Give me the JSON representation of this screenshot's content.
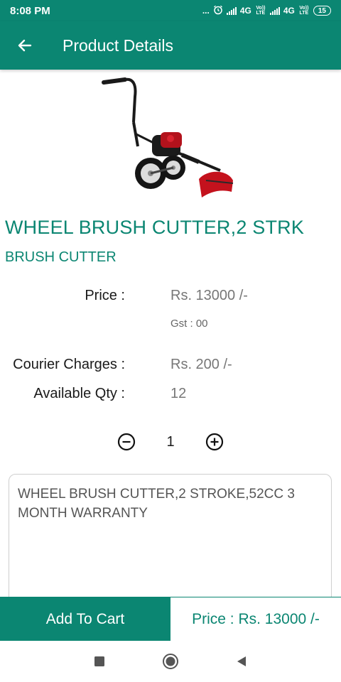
{
  "status_bar": {
    "time": "8:08 PM",
    "dots": "...",
    "network_1": "4G",
    "network_2": "4G",
    "volte_1": "Vo)) LTE",
    "volte_2": "Vo)) LTE",
    "battery": "15",
    "icons": [
      "alarm-icon",
      "signal-icon",
      "battery-icon"
    ]
  },
  "app_bar": {
    "title": "Product Details",
    "back_icon": "back-arrow-icon"
  },
  "product": {
    "image_icon": "wheel-brush-cutter-image",
    "name": "WHEEL BRUSH CUTTER,2 STRK",
    "category": "BRUSH CUTTER",
    "price_label": "Price :",
    "price_value": "Rs. 13000 /-",
    "gst": "Gst : 00",
    "courier_label": "Courier Charges :",
    "courier_value": "Rs. 200 /-",
    "qty_label": "Available Qty :",
    "qty_value": "12",
    "description": "WHEEL BRUSH CUTTER,2 STROKE,52CC 3 MONTH WARRANTY"
  },
  "stepper": {
    "count": "1",
    "minus_icon": "minus-circle-icon",
    "plus_icon": "plus-circle-icon"
  },
  "bottom_bar": {
    "add_to_cart": "Add To Cart",
    "total_price": "Price : Rs. 13000 /-"
  },
  "nav": {
    "icons": [
      "recents-square-icon",
      "home-circle-icon",
      "back-triangle-icon"
    ]
  },
  "colors": {
    "primary": "#0b8672",
    "text_dark": "#1a1a1a",
    "text_gray": "#777777"
  }
}
